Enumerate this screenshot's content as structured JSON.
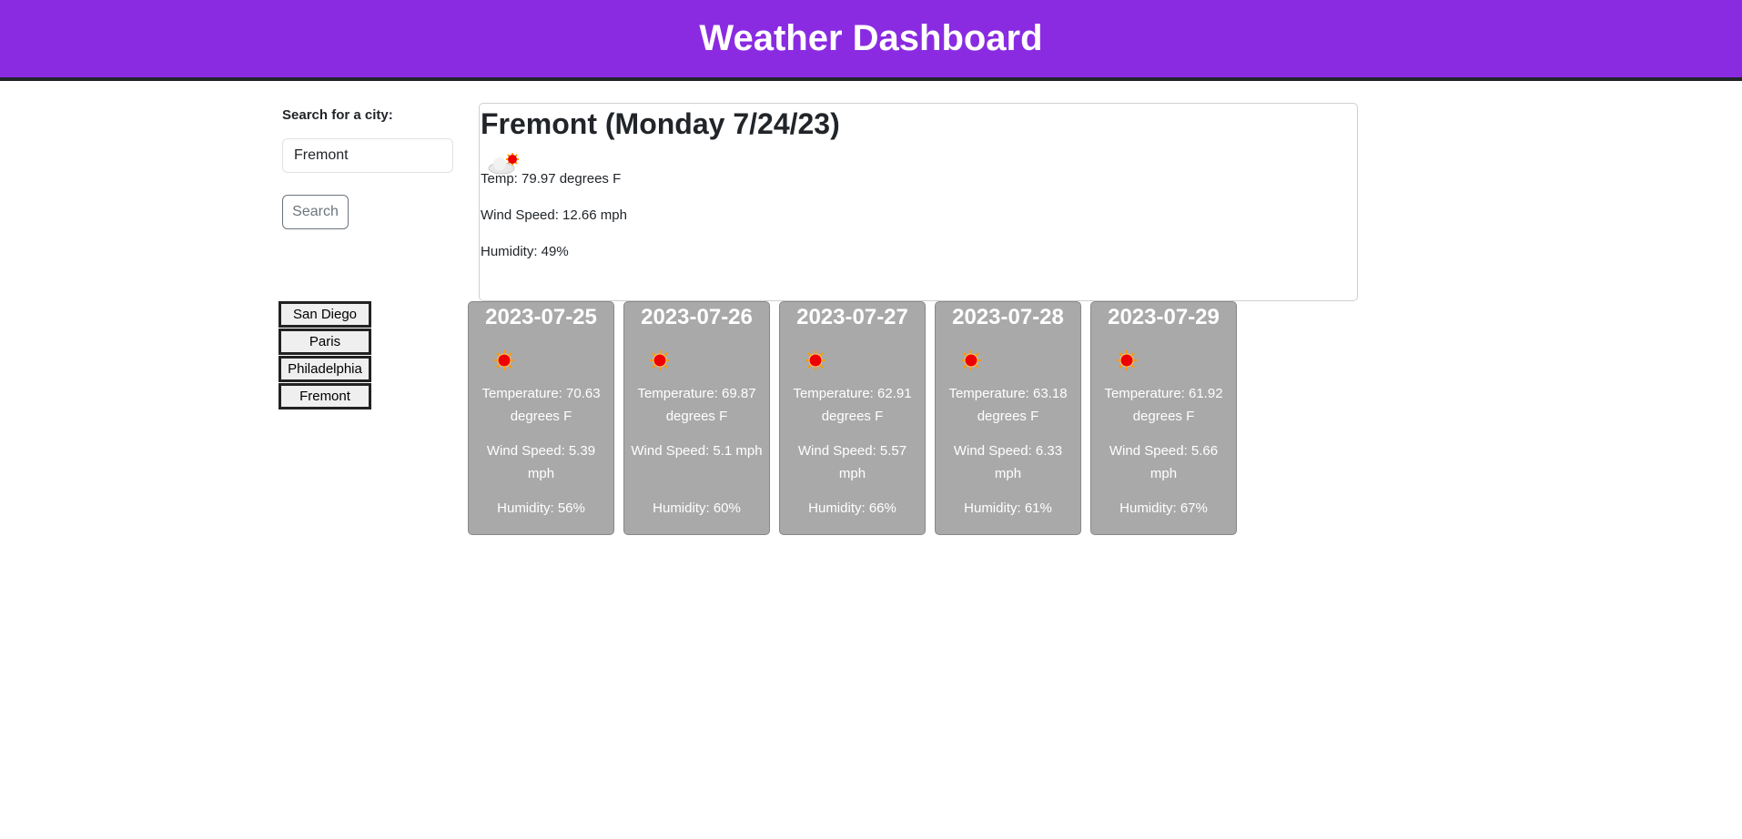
{
  "header": {
    "title": "Weather Dashboard"
  },
  "search": {
    "label": "Search for a city:",
    "value": "Fremont",
    "button": "Search"
  },
  "history": [
    "San Diego",
    "Paris",
    "Philadelphia",
    "Fremont"
  ],
  "current": {
    "title": "Fremont (Monday 7/24/23)",
    "icon": "partly-cloudy-icon",
    "temp": "Temp: 79.97 degrees F",
    "wind": "Wind Speed: 12.66 mph",
    "humidity": "Humidity: 49%"
  },
  "forecast": [
    {
      "date": "2023-07-25",
      "icon": "sun-icon",
      "temp": "Temperature: 70.63 degrees F",
      "wind": "Wind Speed: 5.39 mph",
      "humidity": "Humidity: 56%"
    },
    {
      "date": "2023-07-26",
      "icon": "sun-icon",
      "temp": "Temperature: 69.87 degrees F",
      "wind": "Wind Speed: 5.1 mph",
      "humidity": "Humidity: 60%"
    },
    {
      "date": "2023-07-27",
      "icon": "sun-icon",
      "temp": "Temperature: 62.91 degrees F",
      "wind": "Wind Speed: 5.57 mph",
      "humidity": "Humidity: 66%"
    },
    {
      "date": "2023-07-28",
      "icon": "sun-icon",
      "temp": "Temperature: 63.18 degrees F",
      "wind": "Wind Speed: 6.33 mph",
      "humidity": "Humidity: 61%"
    },
    {
      "date": "2023-07-29",
      "icon": "sun-icon",
      "temp": "Temperature: 61.92 degrees F",
      "wind": "Wind Speed: 5.66 mph",
      "humidity": "Humidity: 67%"
    }
  ],
  "colors": {
    "header": "#8a2be2",
    "card": "#a9a9a9"
  }
}
